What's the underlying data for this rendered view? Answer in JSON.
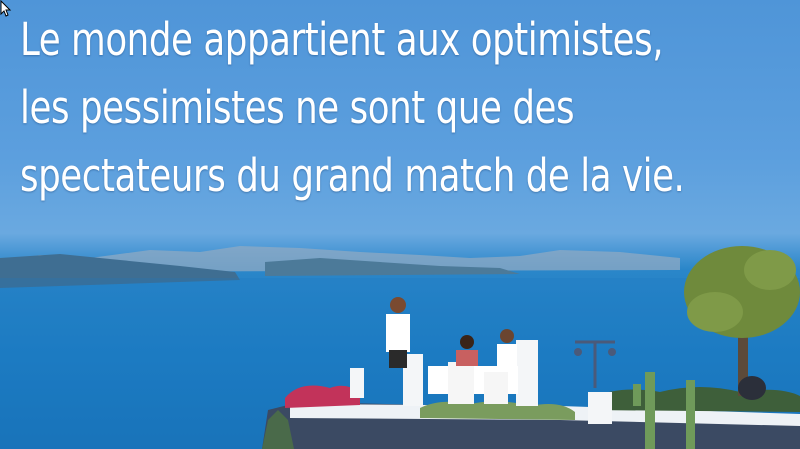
{
  "quote": {
    "line1": "Le monde appartient aux optimistes,",
    "line2": "les pessimistes ne sont que des",
    "line3": "spectateurs du grand match de la vie."
  },
  "colors": {
    "sky": "#5c9fde",
    "sea": "#1c7cc3",
    "text": "#ffffff"
  }
}
